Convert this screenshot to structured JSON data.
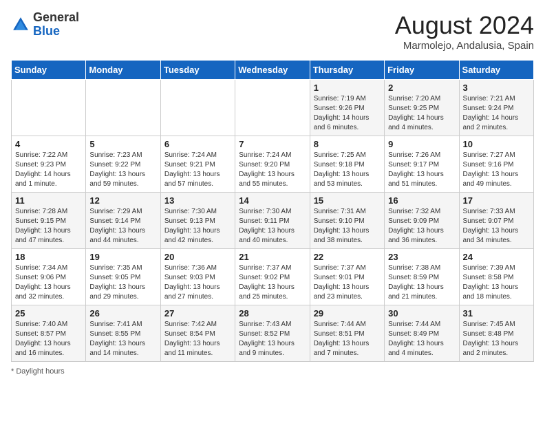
{
  "header": {
    "logo_general": "General",
    "logo_blue": "Blue",
    "month_year": "August 2024",
    "location": "Marmolejo, Andalusia, Spain"
  },
  "days_of_week": [
    "Sunday",
    "Monday",
    "Tuesday",
    "Wednesday",
    "Thursday",
    "Friday",
    "Saturday"
  ],
  "weeks": [
    [
      {
        "day": "",
        "info": ""
      },
      {
        "day": "",
        "info": ""
      },
      {
        "day": "",
        "info": ""
      },
      {
        "day": "",
        "info": ""
      },
      {
        "day": "1",
        "info": "Sunrise: 7:19 AM\nSunset: 9:26 PM\nDaylight: 14 hours\nand 6 minutes."
      },
      {
        "day": "2",
        "info": "Sunrise: 7:20 AM\nSunset: 9:25 PM\nDaylight: 14 hours\nand 4 minutes."
      },
      {
        "day": "3",
        "info": "Sunrise: 7:21 AM\nSunset: 9:24 PM\nDaylight: 14 hours\nand 2 minutes."
      }
    ],
    [
      {
        "day": "4",
        "info": "Sunrise: 7:22 AM\nSunset: 9:23 PM\nDaylight: 14 hours\nand 1 minute."
      },
      {
        "day": "5",
        "info": "Sunrise: 7:23 AM\nSunset: 9:22 PM\nDaylight: 13 hours\nand 59 minutes."
      },
      {
        "day": "6",
        "info": "Sunrise: 7:24 AM\nSunset: 9:21 PM\nDaylight: 13 hours\nand 57 minutes."
      },
      {
        "day": "7",
        "info": "Sunrise: 7:24 AM\nSunset: 9:20 PM\nDaylight: 13 hours\nand 55 minutes."
      },
      {
        "day": "8",
        "info": "Sunrise: 7:25 AM\nSunset: 9:18 PM\nDaylight: 13 hours\nand 53 minutes."
      },
      {
        "day": "9",
        "info": "Sunrise: 7:26 AM\nSunset: 9:17 PM\nDaylight: 13 hours\nand 51 minutes."
      },
      {
        "day": "10",
        "info": "Sunrise: 7:27 AM\nSunset: 9:16 PM\nDaylight: 13 hours\nand 49 minutes."
      }
    ],
    [
      {
        "day": "11",
        "info": "Sunrise: 7:28 AM\nSunset: 9:15 PM\nDaylight: 13 hours\nand 47 minutes."
      },
      {
        "day": "12",
        "info": "Sunrise: 7:29 AM\nSunset: 9:14 PM\nDaylight: 13 hours\nand 44 minutes."
      },
      {
        "day": "13",
        "info": "Sunrise: 7:30 AM\nSunset: 9:13 PM\nDaylight: 13 hours\nand 42 minutes."
      },
      {
        "day": "14",
        "info": "Sunrise: 7:30 AM\nSunset: 9:11 PM\nDaylight: 13 hours\nand 40 minutes."
      },
      {
        "day": "15",
        "info": "Sunrise: 7:31 AM\nSunset: 9:10 PM\nDaylight: 13 hours\nand 38 minutes."
      },
      {
        "day": "16",
        "info": "Sunrise: 7:32 AM\nSunset: 9:09 PM\nDaylight: 13 hours\nand 36 minutes."
      },
      {
        "day": "17",
        "info": "Sunrise: 7:33 AM\nSunset: 9:07 PM\nDaylight: 13 hours\nand 34 minutes."
      }
    ],
    [
      {
        "day": "18",
        "info": "Sunrise: 7:34 AM\nSunset: 9:06 PM\nDaylight: 13 hours\nand 32 minutes."
      },
      {
        "day": "19",
        "info": "Sunrise: 7:35 AM\nSunset: 9:05 PM\nDaylight: 13 hours\nand 29 minutes."
      },
      {
        "day": "20",
        "info": "Sunrise: 7:36 AM\nSunset: 9:03 PM\nDaylight: 13 hours\nand 27 minutes."
      },
      {
        "day": "21",
        "info": "Sunrise: 7:37 AM\nSunset: 9:02 PM\nDaylight: 13 hours\nand 25 minutes."
      },
      {
        "day": "22",
        "info": "Sunrise: 7:37 AM\nSunset: 9:01 PM\nDaylight: 13 hours\nand 23 minutes."
      },
      {
        "day": "23",
        "info": "Sunrise: 7:38 AM\nSunset: 8:59 PM\nDaylight: 13 hours\nand 21 minutes."
      },
      {
        "day": "24",
        "info": "Sunrise: 7:39 AM\nSunset: 8:58 PM\nDaylight: 13 hours\nand 18 minutes."
      }
    ],
    [
      {
        "day": "25",
        "info": "Sunrise: 7:40 AM\nSunset: 8:57 PM\nDaylight: 13 hours\nand 16 minutes."
      },
      {
        "day": "26",
        "info": "Sunrise: 7:41 AM\nSunset: 8:55 PM\nDaylight: 13 hours\nand 14 minutes."
      },
      {
        "day": "27",
        "info": "Sunrise: 7:42 AM\nSunset: 8:54 PM\nDaylight: 13 hours\nand 11 minutes."
      },
      {
        "day": "28",
        "info": "Sunrise: 7:43 AM\nSunset: 8:52 PM\nDaylight: 13 hours\nand 9 minutes."
      },
      {
        "day": "29",
        "info": "Sunrise: 7:44 AM\nSunset: 8:51 PM\nDaylight: 13 hours\nand 7 minutes."
      },
      {
        "day": "30",
        "info": "Sunrise: 7:44 AM\nSunset: 8:49 PM\nDaylight: 13 hours\nand 4 minutes."
      },
      {
        "day": "31",
        "info": "Sunrise: 7:45 AM\nSunset: 8:48 PM\nDaylight: 13 hours\nand 2 minutes."
      }
    ]
  ],
  "footer": {
    "note": "Daylight hours"
  }
}
